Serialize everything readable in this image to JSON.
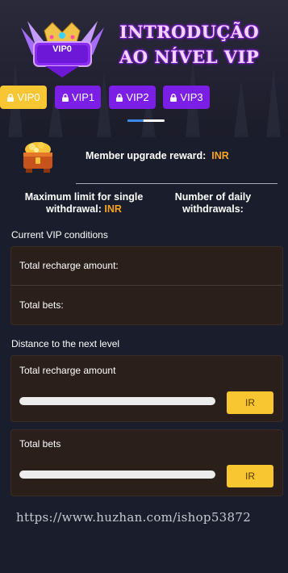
{
  "header": {
    "badge_label": "VIP0",
    "title_line1": "INTRODUÇÃO",
    "title_line2": "AO NÍVEL VIP"
  },
  "tabs": [
    {
      "label": "VIP0",
      "active": true
    },
    {
      "label": "VIP1",
      "active": false
    },
    {
      "label": "VIP2",
      "active": false
    },
    {
      "label": "VIP3",
      "active": false
    }
  ],
  "reward": {
    "label": "Member upgrade reward:",
    "currency": "INR"
  },
  "limits": {
    "withdrawal_line1": "Maximum limit for single",
    "withdrawal_line2": "withdrawal:",
    "withdrawal_currency": "INR",
    "daily_line1": "Number of daily",
    "daily_line2": "withdrawals:"
  },
  "current": {
    "title": "Current VIP conditions",
    "recharge_label": "Total recharge amount:",
    "bets_label": "Total bets:"
  },
  "next": {
    "title": "Distance to the next level",
    "recharge_label": "Total recharge amount",
    "recharge_button": "IR",
    "recharge_progress": 0,
    "bets_label": "Total bets",
    "bets_button": "IR",
    "bets_progress": 0
  },
  "watermark": "https://www.huzhan.com/ishop53872",
  "colors": {
    "accent_purple": "#7b1fe6",
    "accent_yellow": "#f7c632",
    "currency_orange": "#f7a51c",
    "card_bg": "#2b1f1b"
  }
}
